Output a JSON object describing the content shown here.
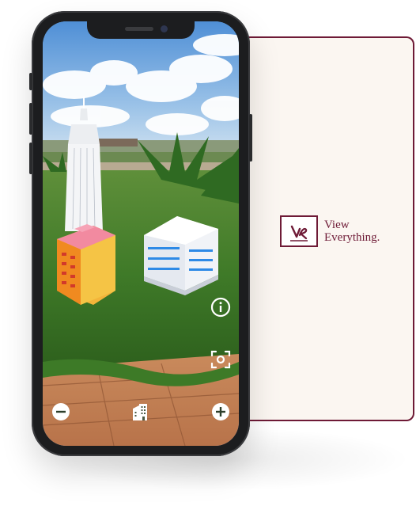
{
  "brand": {
    "line1": "View",
    "line2": "Everything.",
    "logo_icon": "vr-monogram-icon",
    "color": "#6e1a36"
  },
  "ar_controls": {
    "info_icon": "info-icon",
    "scan_icon": "scan-focus-icon",
    "zoom_out_icon": "zoom-out-icon",
    "building_icon": "building-icon",
    "zoom_in_icon": "zoom-in-icon"
  },
  "colors": {
    "card_background": "#fbf6f1",
    "accent": "#6e1a36",
    "phone_frame": "#1c1d1f"
  }
}
